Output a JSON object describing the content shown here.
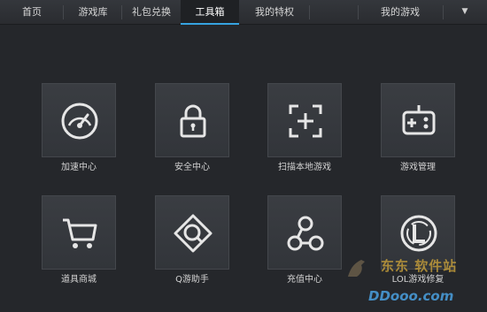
{
  "nav": {
    "tabs": [
      {
        "label": "首页"
      },
      {
        "label": "游戏库"
      },
      {
        "label": "礼包兑换"
      },
      {
        "label": "工具箱"
      },
      {
        "label": "我的特权"
      }
    ],
    "active_tab": "工具箱",
    "my_games": "我的游戏",
    "menu_arrow": "▼"
  },
  "tools": [
    {
      "label": "加速中心",
      "icon": "speedometer-icon"
    },
    {
      "label": "安全中心",
      "icon": "lock-icon"
    },
    {
      "label": "扫描本地游戏",
      "icon": "scan-plus-icon"
    },
    {
      "label": "游戏管理",
      "icon": "gamepad-icon"
    },
    {
      "label": "道具商城",
      "icon": "shopping-cart-icon"
    },
    {
      "label": "Q游助手",
      "icon": "q-diamond-icon"
    },
    {
      "label": "充值中心",
      "icon": "recharge-nodes-icon"
    },
    {
      "label": "LOL游戏修复",
      "icon": "lol-logo-icon"
    }
  ],
  "watermark": {
    "text": "东东 软件站",
    "url": "DDooo.com"
  },
  "colors": {
    "background": "#25272b",
    "tile": "#393c41",
    "accent": "#36a3e0"
  }
}
